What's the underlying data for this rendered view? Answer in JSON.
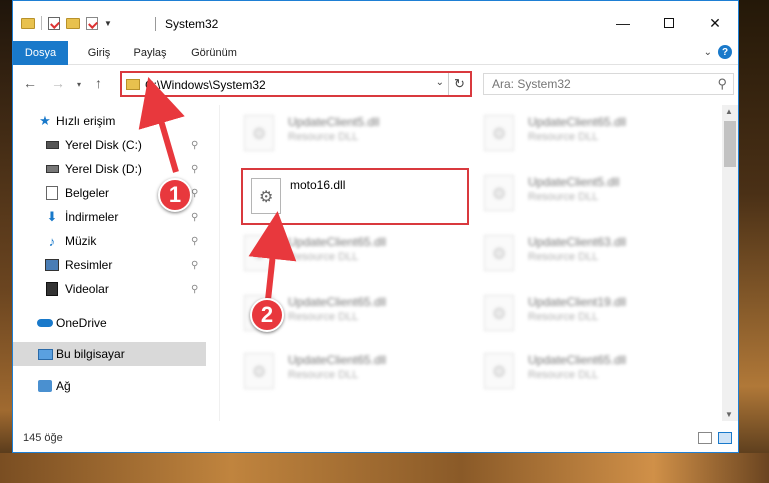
{
  "window": {
    "title": "System32",
    "controls": {
      "minimize": "—",
      "maximize": "",
      "close": "✕"
    }
  },
  "ribbon": {
    "tabs": [
      {
        "label": "Dosya",
        "active": true
      },
      {
        "label": "Giriş",
        "active": false
      },
      {
        "label": "Paylaş",
        "active": false
      },
      {
        "label": "Görünüm",
        "active": false
      }
    ],
    "help": "?"
  },
  "navigation": {
    "address_path": "C:\\Windows\\System32",
    "search_placeholder": "Ara: System32"
  },
  "sidebar": {
    "items": [
      {
        "label": "Hızlı erişim",
        "icon": "star-icon",
        "pinned": false
      },
      {
        "label": "Yerel Disk (C:)",
        "icon": "drive-icon",
        "pinned": true
      },
      {
        "label": "Yerel Disk (D:)",
        "icon": "drive-icon",
        "pinned": true
      },
      {
        "label": "Belgeler",
        "icon": "documents-icon",
        "pinned": true
      },
      {
        "label": "İndirmeler",
        "icon": "download-icon",
        "pinned": true
      },
      {
        "label": "Müzik",
        "icon": "music-icon",
        "pinned": true
      },
      {
        "label": "Resimler",
        "icon": "pictures-icon",
        "pinned": true
      },
      {
        "label": "Videolar",
        "icon": "videos-icon",
        "pinned": true
      },
      {
        "label": "OneDrive",
        "icon": "onedrive-icon",
        "pinned": false
      },
      {
        "label": "Bu bilgisayar",
        "icon": "this-pc-icon",
        "pinned": false,
        "selected": true
      },
      {
        "label": "Ağ",
        "icon": "network-icon",
        "pinned": false
      }
    ],
    "pin_glyph": "📌"
  },
  "files": {
    "left_column": [
      {
        "name": "UpdateClient5.dll",
        "type": "Resource DLL",
        "blurred": true
      },
      {
        "name": "moto16.dll",
        "type": "",
        "blurred": false,
        "highlighted": true
      },
      {
        "name": "UpdateClient65.dll",
        "type": "Resource DLL",
        "blurred": true
      },
      {
        "name": "UpdateClient65.dll",
        "type": "Resource DLL",
        "blurred": true
      },
      {
        "name": "UpdateClient65.dll",
        "type": "Resource DLL",
        "blurred": true
      }
    ],
    "right_column": [
      {
        "name": "UpdateClient65.dll",
        "type": "Resource DLL",
        "blurred": true
      },
      {
        "name": "UpdateClient5.dll",
        "type": "Resource DLL",
        "blurred": true
      },
      {
        "name": "UpdateClient63.dll",
        "type": "Resource DLL",
        "blurred": true
      },
      {
        "name": "UpdateClient19.dll",
        "type": "Resource DLL",
        "blurred": true
      },
      {
        "name": "UpdateClient65.dll",
        "type": "Resource DLL",
        "blurred": true
      }
    ]
  },
  "status": {
    "item_count": "145 öğe"
  },
  "annotations": {
    "callout_1": "1",
    "callout_2": "2",
    "highlight_color": "#d9393e",
    "callout_color": "#e8383d"
  },
  "colors": {
    "accent": "#1979ca",
    "window_border": "#1e7fd4"
  }
}
